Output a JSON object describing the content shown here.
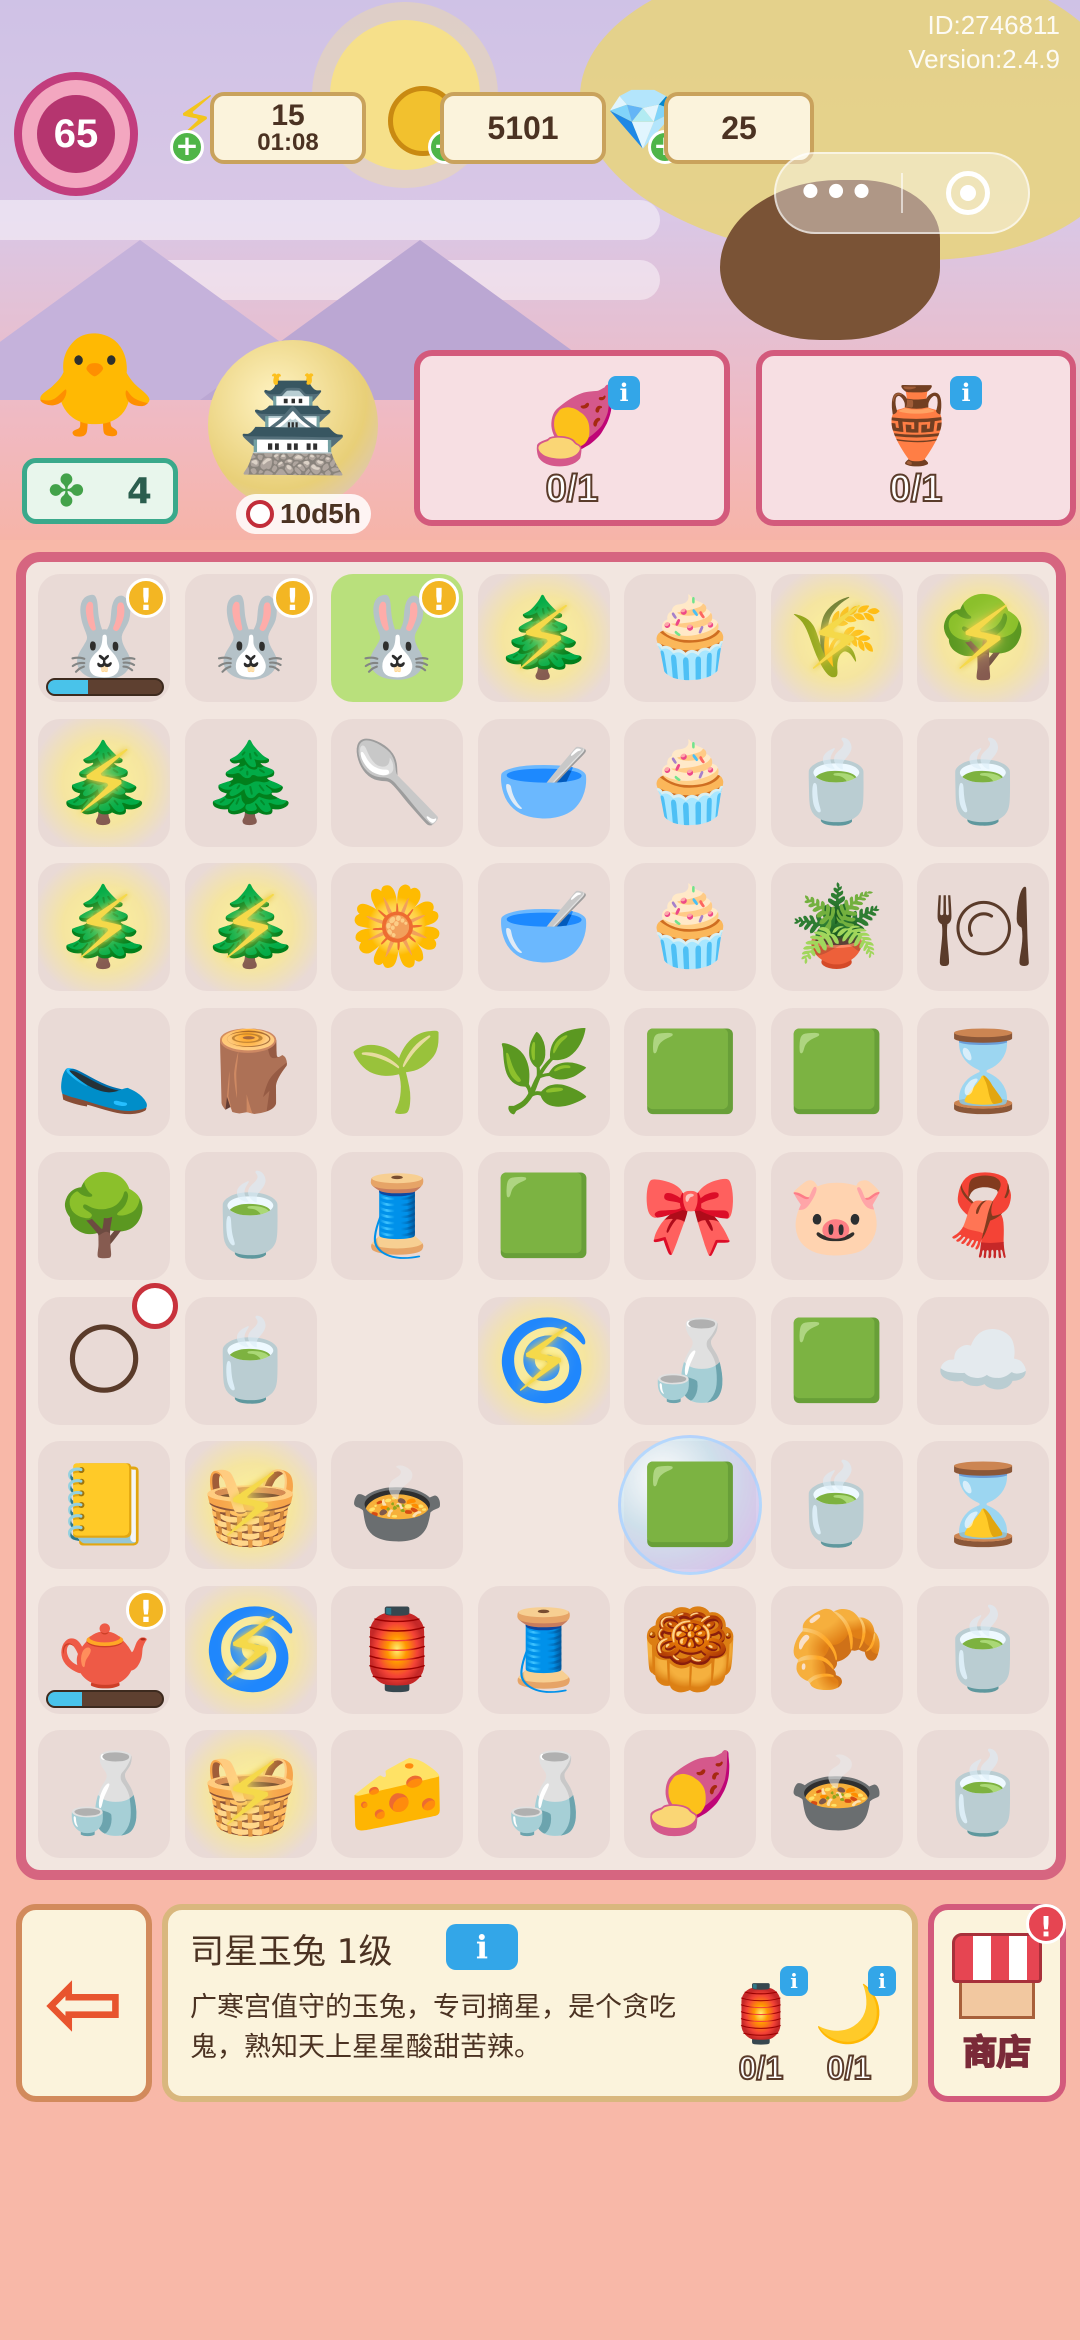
{
  "meta": {
    "id_text": "ID:2746811",
    "version_text": "Version:2.4.9"
  },
  "hud": {
    "level": "65",
    "energy": {
      "value": "15",
      "timer": "01:08",
      "icon": "lightning-icon"
    },
    "coins": {
      "value": "5101",
      "icon": "coin-icon"
    },
    "gems": {
      "value": "25",
      "icon": "gem-icon"
    },
    "capsule": {
      "more_label": "•••"
    }
  },
  "orders": {
    "clover_count": "4",
    "event_timer": "10d5h",
    "cards": [
      {
        "item": "purple-mooncake-icon",
        "glyph": "🍠",
        "count": "0/1"
      },
      {
        "item": "jade-bowl-icon",
        "glyph": "🏺",
        "count": "0/1"
      }
    ]
  },
  "board": {
    "cells": [
      {
        "g": "🐰",
        "t": "generator",
        "alert": true,
        "progress": 0.35
      },
      {
        "g": "🐰",
        "t": "generator",
        "alert": true
      },
      {
        "g": "🐰",
        "t": "generator",
        "alert": true,
        "selected": true
      },
      {
        "g": "🌲",
        "t": "locked"
      },
      {
        "g": "🧁",
        "t": "item"
      },
      {
        "g": "🌾",
        "t": "locked"
      },
      {
        "g": "🌳",
        "t": "locked"
      },
      {
        "g": "🌲",
        "t": "locked"
      },
      {
        "g": "🌲",
        "t": "item"
      },
      {
        "g": "🥄",
        "t": "item"
      },
      {
        "g": "🥣",
        "t": "item"
      },
      {
        "g": "🧁",
        "t": "item"
      },
      {
        "g": "🍵",
        "t": "item"
      },
      {
        "g": "🍵",
        "t": "item"
      },
      {
        "g": "🌲",
        "t": "locked"
      },
      {
        "g": "🌲",
        "t": "locked"
      },
      {
        "g": "🌼",
        "t": "item"
      },
      {
        "g": "🥣",
        "t": "item"
      },
      {
        "g": "🧁",
        "t": "item"
      },
      {
        "g": "🪴",
        "t": "item"
      },
      {
        "g": "🍽",
        "t": "item"
      },
      {
        "g": "🥿",
        "t": "item"
      },
      {
        "g": "🪵",
        "t": "item"
      },
      {
        "g": "🌱",
        "t": "item"
      },
      {
        "g": "🌿",
        "t": "item"
      },
      {
        "g": "🟩",
        "t": "item"
      },
      {
        "g": "🟩",
        "t": "item"
      },
      {
        "g": "⌛",
        "t": "item"
      },
      {
        "g": "🌳",
        "t": "item"
      },
      {
        "g": "🍵",
        "t": "item"
      },
      {
        "g": "🧵",
        "t": "item"
      },
      {
        "g": "🟩",
        "t": "item"
      },
      {
        "g": "🎀",
        "t": "item"
      },
      {
        "g": "🐷",
        "t": "item"
      },
      {
        "g": "🧣",
        "t": "item"
      },
      {
        "g": "🌕",
        "t": "item",
        "timer": true
      },
      {
        "g": "🍵",
        "t": "item"
      },
      {
        "g": "",
        "t": "empty"
      },
      {
        "g": "🌀",
        "t": "locked"
      },
      {
        "g": "🍶",
        "t": "item"
      },
      {
        "g": "🟩",
        "t": "item"
      },
      {
        "g": "☁️",
        "t": "item"
      },
      {
        "g": "📒",
        "t": "item"
      },
      {
        "g": "🧺",
        "t": "locked"
      },
      {
        "g": "🍲",
        "t": "item"
      },
      {
        "g": "",
        "t": "empty"
      },
      {
        "g": "🟩",
        "t": "bubble"
      },
      {
        "g": "🍵",
        "t": "item"
      },
      {
        "g": "⌛",
        "t": "item"
      },
      {
        "g": "🫖",
        "t": "generator",
        "alert": true,
        "progress": 0.3
      },
      {
        "g": "🌀",
        "t": "locked"
      },
      {
        "g": "🏮",
        "t": "item"
      },
      {
        "g": "🧵",
        "t": "item"
      },
      {
        "g": "🥮",
        "t": "item"
      },
      {
        "g": "🥐",
        "t": "item"
      },
      {
        "g": "🍵",
        "t": "item"
      },
      {
        "g": "🍶",
        "t": "item"
      },
      {
        "g": "🧺",
        "t": "locked"
      },
      {
        "g": "🧀",
        "t": "item"
      },
      {
        "g": "🍶",
        "t": "item"
      },
      {
        "g": "🍠",
        "t": "item"
      },
      {
        "g": "🍲",
        "t": "item"
      },
      {
        "g": "🍵",
        "t": "item"
      }
    ]
  },
  "bottom": {
    "title": "司星玉兔 1级",
    "description": "广寒宫值守的玉兔，专司摘星，是个贪吃鬼，熟知天上星星酸甜苦辣。",
    "requirements": [
      {
        "icon": "lantern-box-icon",
        "glyph": "🏮",
        "count": "0/1"
      },
      {
        "icon": "moon-cloud-icon",
        "glyph": "🌙",
        "count": "0/1"
      }
    ],
    "shop_label": "商店"
  }
}
